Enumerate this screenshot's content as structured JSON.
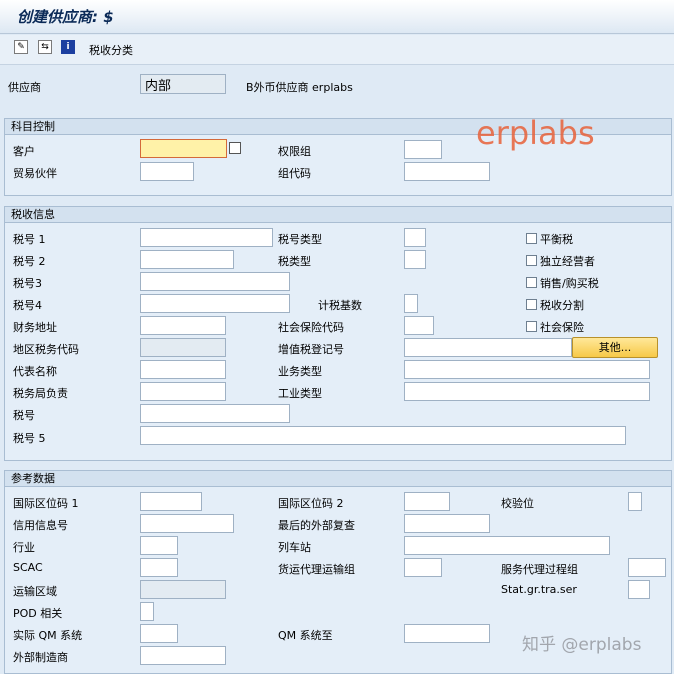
{
  "title": "创建供应商: $",
  "toolbar": {
    "tax_category": "税收分类"
  },
  "vendor": {
    "label": "供应商",
    "value": "内部",
    "name": "B外币供应商 erplabs"
  },
  "watermark": "erplabs",
  "zhihu": "知乎 @erplabs",
  "account_control": {
    "header": "科目控制",
    "customer": "客户",
    "auth_group": "权限组",
    "trading_partner": "贸易伙伴",
    "group_code": "组代码"
  },
  "tax_info": {
    "header": "税收信息",
    "tax1": "税号 1",
    "tax2": "税号 2",
    "tax3": "税号3",
    "tax4": "税号4",
    "fiscal_address": "财务地址",
    "region_tax_code": "地区税务代码",
    "rep_name": "代表名称",
    "tax_office": "税务局负责",
    "tax_no": "税号",
    "tax5": "税号 5",
    "tax_no_type": "税号类型",
    "tax_type": "税类型",
    "tax_base": "计税基数",
    "social_ins_code": "社会保险代码",
    "vat_reg_no": "增值税登记号",
    "business_type": "业务类型",
    "industry_type": "工业类型",
    "other_button": "其他...",
    "equalization_tax": "平衡税",
    "sole_proprietor": "独立经营者",
    "sales_purchase_tax": "销售/购买税",
    "tax_split": "税收分割",
    "social_insurance": "社会保险"
  },
  "reference": {
    "header": "参考数据",
    "intl_loc1": "国际区位码 1",
    "credit_info": "信用信息号",
    "industry": "行业",
    "scac": "SCAC",
    "transport_zone": "运输区域",
    "pod_rel": "POD 相关",
    "actual_qm": "实际 QM 系统",
    "ext_manufacturer": "外部制造商",
    "intl_loc2": "国际区位码 2",
    "last_ext_review": "最后的外部复查",
    "train_station": "列车站",
    "forwarding_group": "货运代理运输组",
    "qm_system_to": "QM 系统至",
    "check_digit": "校验位",
    "service_agent_proc": "服务代理过程组",
    "stat_gr": "Stat.gr.tra.ser"
  }
}
